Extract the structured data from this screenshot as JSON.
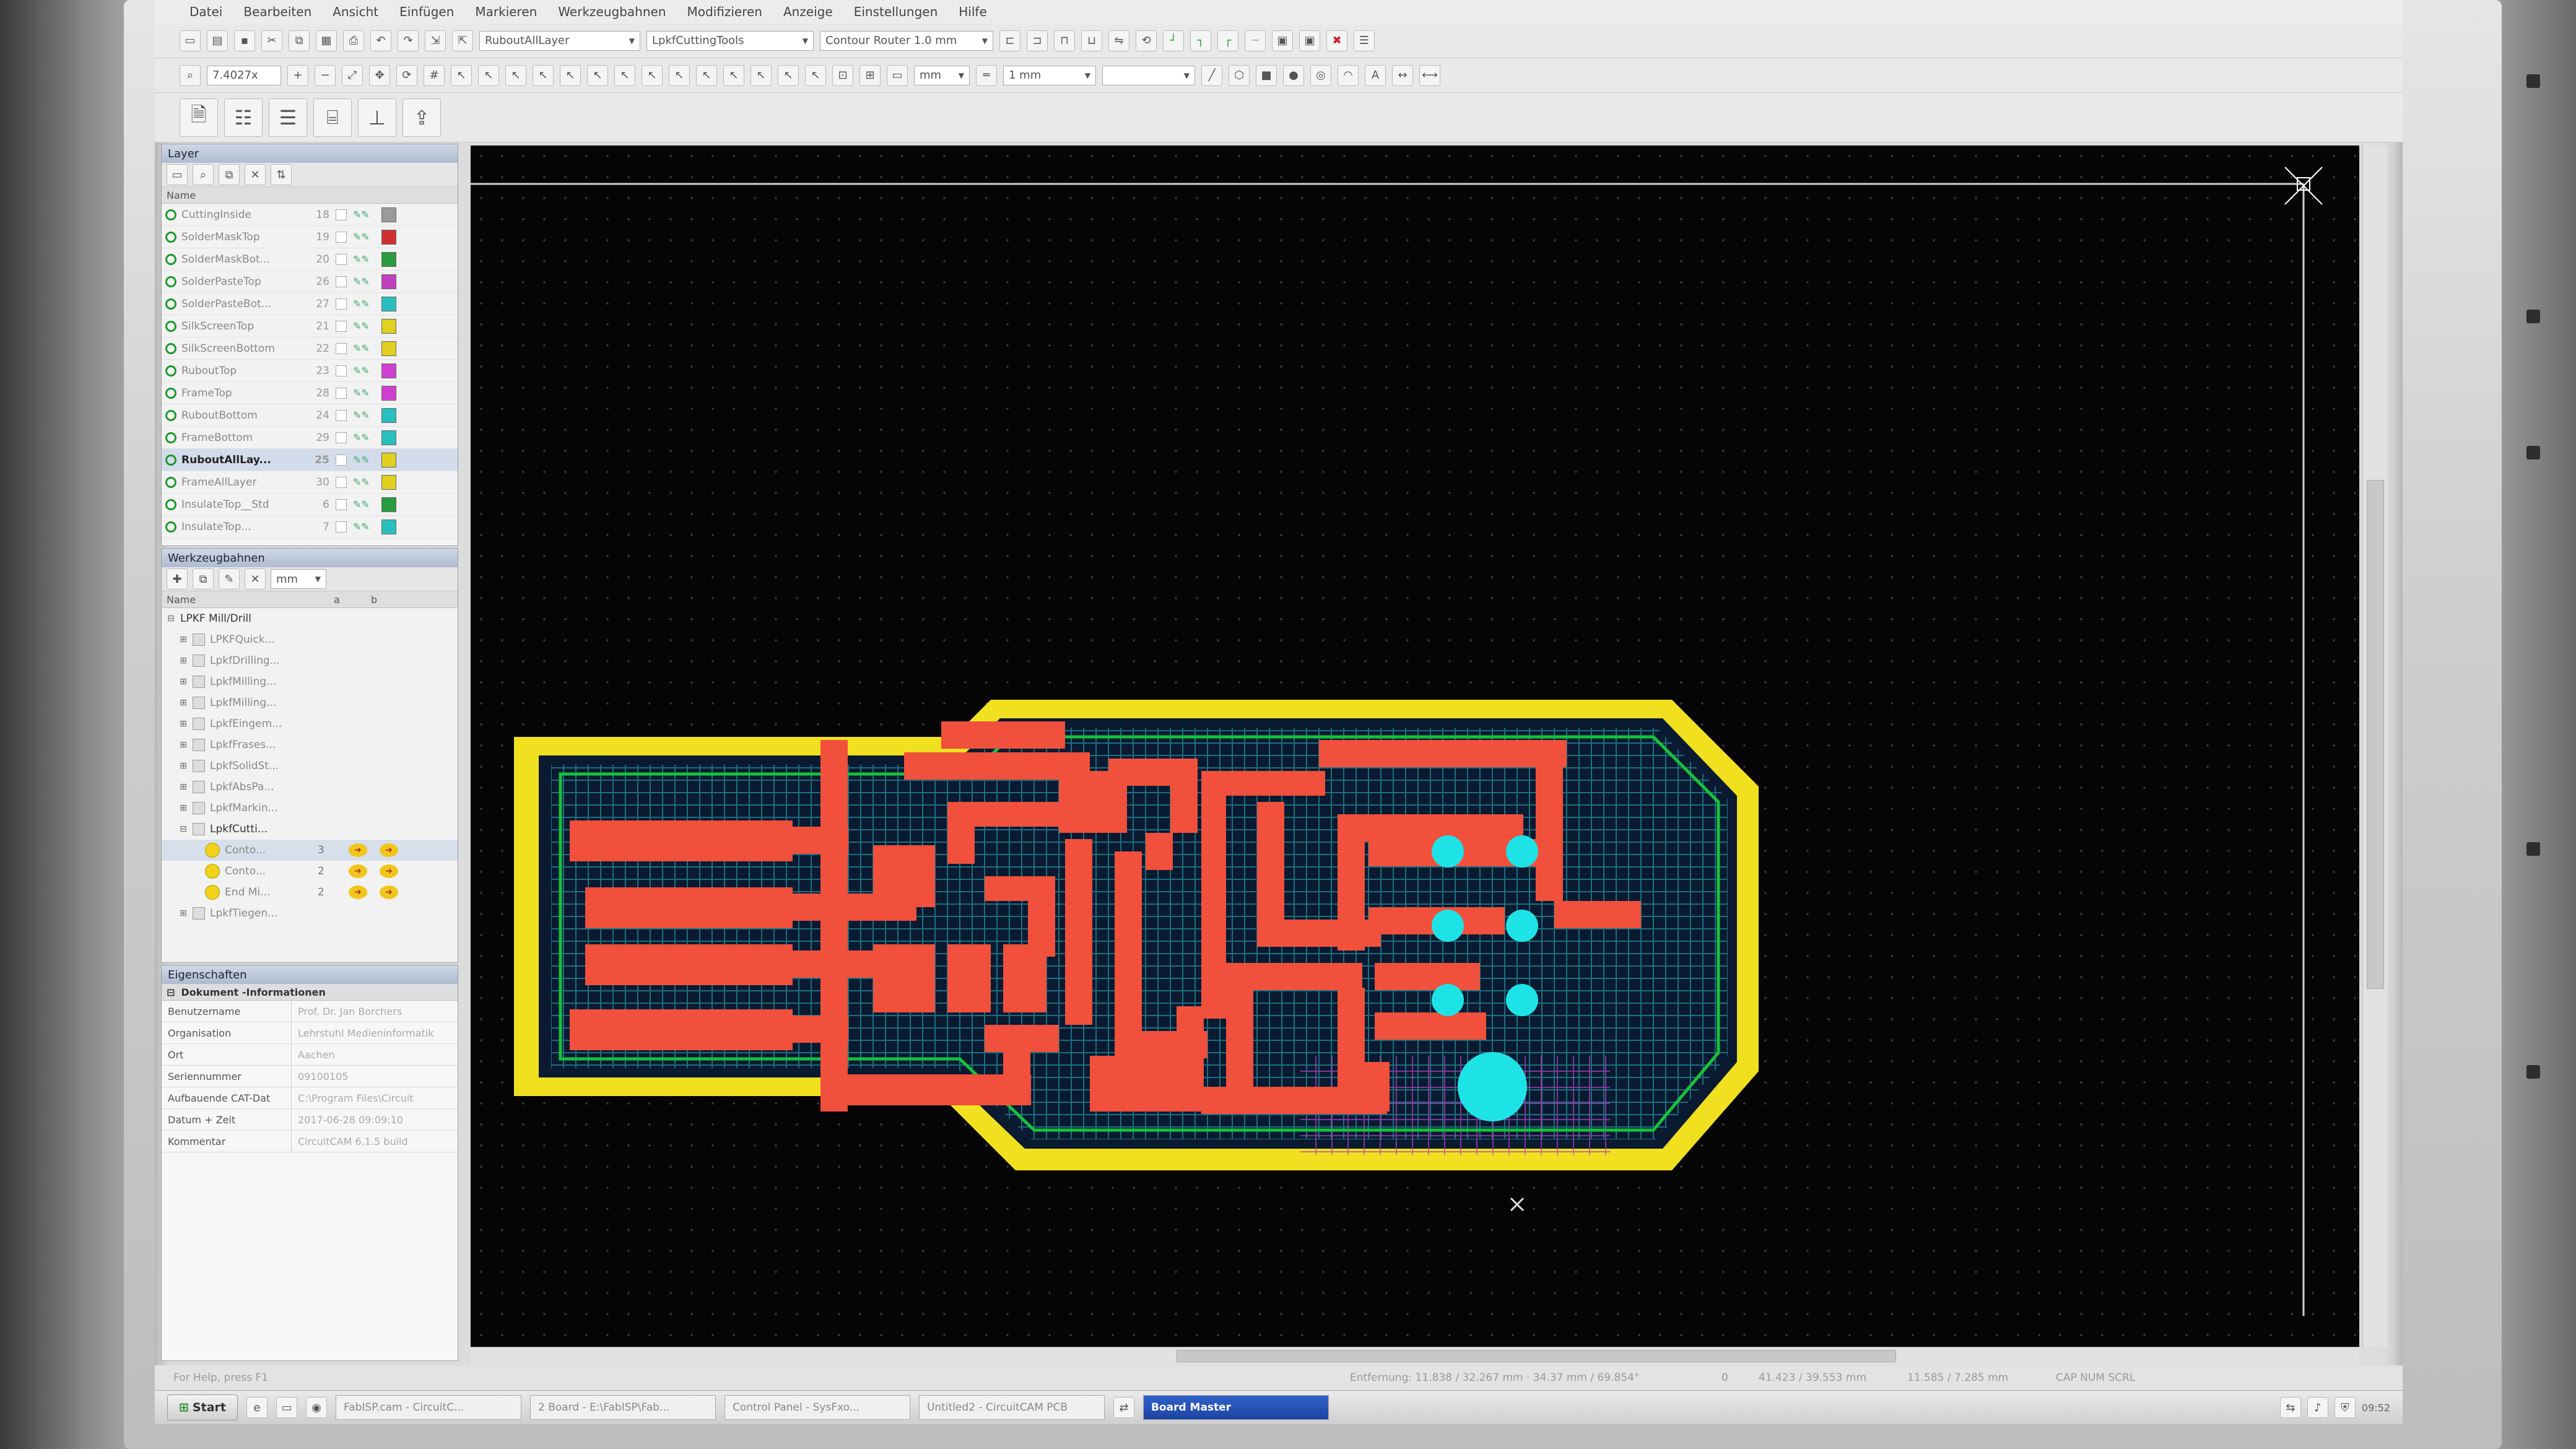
{
  "menu": [
    "Datei",
    "Bearbeiten",
    "Ansicht",
    "Einfügen",
    "Markieren",
    "Werkzeugbahnen",
    "Modifizieren",
    "Anzeige",
    "Einstellungen",
    "Hilfe"
  ],
  "toolbar": {
    "zoom": "7.4027x",
    "layer_combo": "RuboutAllLayer",
    "tool_combo": "LpkfCuttingTools",
    "router_combo": "Contour Router 1.0 mm",
    "unit_combo": "mm",
    "width_combo": "1 mm"
  },
  "layers": {
    "title": "Layer",
    "col_name": "Name",
    "rows": [
      {
        "name": "CuttingInside",
        "num": "18",
        "color": "#9a9a9a"
      },
      {
        "name": "SolderMaskTop",
        "num": "19",
        "color": "#d03030"
      },
      {
        "name": "SolderMaskBot...",
        "num": "20",
        "color": "#2a9b40"
      },
      {
        "name": "SolderPasteTop",
        "num": "26",
        "color": "#c040c0"
      },
      {
        "name": "SolderPasteBot...",
        "num": "27",
        "color": "#2abfbf"
      },
      {
        "name": "SilkScreenTop",
        "num": "21",
        "color": "#e0d020"
      },
      {
        "name": "SilkScreenBottom",
        "num": "22",
        "color": "#e0d020"
      },
      {
        "name": "RuboutTop",
        "num": "23",
        "color": "#d040d0"
      },
      {
        "name": "FrameTop",
        "num": "28",
        "color": "#d040d0"
      },
      {
        "name": "RuboutBottom",
        "num": "24",
        "color": "#2abfbf"
      },
      {
        "name": "FrameBottom",
        "num": "29",
        "color": "#2abfbf"
      },
      {
        "name": "RuboutAllLay...",
        "num": "25",
        "color": "#e0d020",
        "selected": true
      },
      {
        "name": "FrameAllLayer",
        "num": "30",
        "color": "#e0d020"
      },
      {
        "name": "InsulateTop__Std",
        "num": "6",
        "color": "#2a9b40"
      },
      {
        "name": "InsulateTop...",
        "num": "7",
        "color": "#2abfbf"
      }
    ]
  },
  "tools": {
    "title": "Werkzeugbahnen",
    "unit": "mm",
    "col_name": "Name",
    "col_a": "a",
    "col_b": "b",
    "root": "LPKF Mill/Drill",
    "items": [
      "LPKFQuick...",
      "LpkfDrilling...",
      "LpkfMilling...",
      "LpkfMilling...",
      "LpkfEingem...",
      "LpkfFrases...",
      "LpkfSolidSt...",
      "LpkfAbsPa...",
      "LpkfMarkin..."
    ],
    "group": "LpkfCutti...",
    "subitems": [
      {
        "name": "Conto...",
        "num": "3"
      },
      {
        "name": "Conto...",
        "num": "2"
      },
      {
        "name": "End Mi...",
        "num": "2"
      }
    ],
    "tail": "LpkfTiegen..."
  },
  "info": {
    "title": "Eigenschaften",
    "header": "Dokument -Informationen",
    "rows": [
      {
        "k": "Benutzername",
        "v": "Prof. Dr. Jan Borchers"
      },
      {
        "k": "Organisation",
        "v": "Lehrstuhl Medieninformatik"
      },
      {
        "k": "Ort",
        "v": "Aachen"
      },
      {
        "k": "Seriennummer",
        "v": "09100105"
      },
      {
        "k": "Aufbauende CAT-Dat",
        "v": "C:\\Program Files\\Circuit"
      },
      {
        "k": "Datum + Zeit",
        "v": "2017-06-28 09:09:10"
      },
      {
        "k": "Kommentar",
        "v": "CircuitCAM 6.1.5 build"
      }
    ]
  },
  "status": {
    "help": "For Help, press F1",
    "distance": "Entfernung: 11.838 / 32.267 mm · 34.37 mm / 69.854°",
    "zero": "0",
    "coord1": "41.423 / 39.553 mm",
    "coord2": "11.585 / 7.285 mm",
    "mode": "CAP NUM SCRL"
  },
  "taskbar": {
    "start": "Start",
    "tasks": [
      "FabISP.cam - CircuitC...",
      "2 Board - E:\\FabISP\\Fab...",
      "Control Panel - SysFxo...",
      "Untitled2 - CircuitCAM PCB"
    ],
    "active": "Board Master",
    "clock": "09:52"
  },
  "colors": {
    "copper": "#f0503c",
    "outline": "#f0e020",
    "pad": "#1ee3e6",
    "insulate": "#16c23a",
    "hatch": "#2bb5c4",
    "rubout": "#b040c0"
  }
}
